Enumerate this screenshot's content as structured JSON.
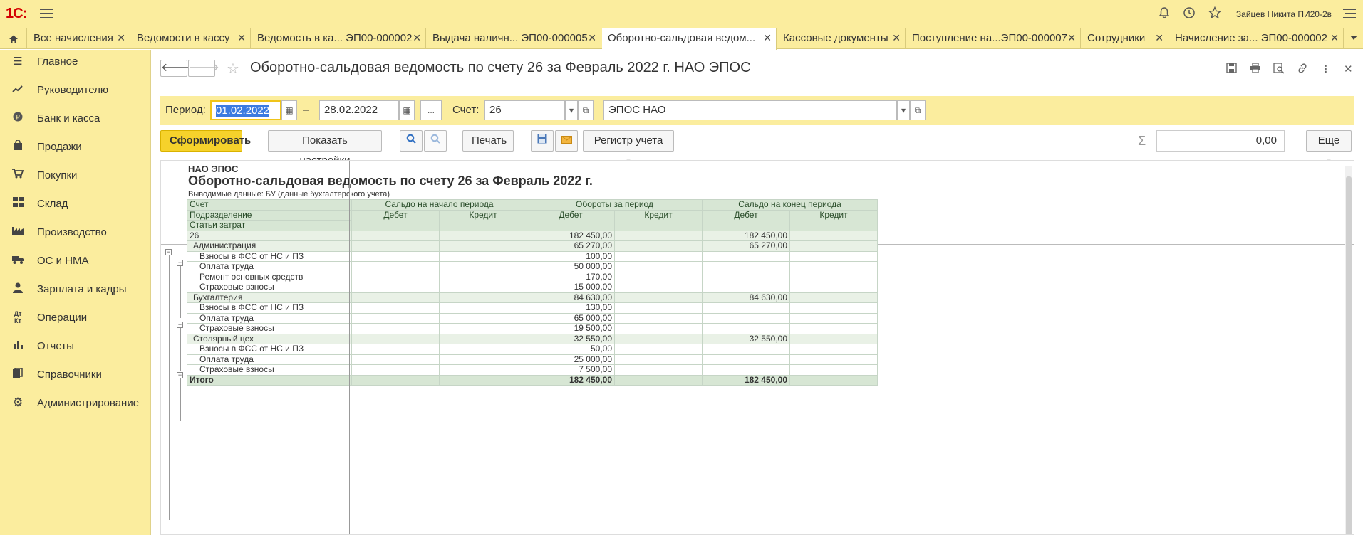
{
  "header": {
    "user": "Зайцев Никита ПИ20-2в"
  },
  "tabs": [
    {
      "label": "Все начисления"
    },
    {
      "label": "Ведомости в кассу"
    },
    {
      "label": "Ведомость в ка... ЭП00-000002"
    },
    {
      "label": "Выдача наличн... ЭП00-000005"
    },
    {
      "label": "Оборотно-сальдовая ведом..."
    },
    {
      "label": "Кассовые документы"
    },
    {
      "label": "Поступление на...ЭП00-000007"
    },
    {
      "label": "Сотрудники"
    },
    {
      "label": "Начисление за... ЭП00-000002"
    }
  ],
  "sidebar": [
    {
      "label": "Главное",
      "icon": "menu-icon"
    },
    {
      "label": "Руководителю",
      "icon": "chart-line-icon"
    },
    {
      "label": "Банк и касса",
      "icon": "ruble-icon"
    },
    {
      "label": "Продажи",
      "icon": "shopping-bag-icon"
    },
    {
      "label": "Покупки",
      "icon": "cart-icon"
    },
    {
      "label": "Склад",
      "icon": "warehouse-icon"
    },
    {
      "label": "Производство",
      "icon": "factory-icon"
    },
    {
      "label": "ОС и НМА",
      "icon": "truck-icon"
    },
    {
      "label": "Зарплата и кадры",
      "icon": "person-icon"
    },
    {
      "label": "Операции",
      "icon": "operations-icon"
    },
    {
      "label": "Отчеты",
      "icon": "bar-chart-icon"
    },
    {
      "label": "Справочники",
      "icon": "books-icon"
    },
    {
      "label": "Администрирование",
      "icon": "gear-icon"
    }
  ],
  "document": {
    "title": "Оборотно-сальдовая ведомость по счету 26 за Февраль 2022 г. НАО ЭПОС"
  },
  "filters": {
    "period_label": "Период:",
    "date_from": "01.02.2022",
    "dash": "–",
    "date_to": "28.02.2022",
    "ellipsis": "...",
    "account_label": "Счет:",
    "account": "26",
    "organization": "ЭПОС НАО"
  },
  "toolbar": {
    "generate": "Сформировать",
    "show_settings": "Показать настройки",
    "print": "Печать",
    "register": "Регистр учета",
    "sum": "0,00",
    "more": "Еще"
  },
  "report": {
    "org": "НАО ЭПОС",
    "title": "Оборотно-сальдовая ведомость по счету 26 за Февраль 2022 г.",
    "subtitle": "Выводимые данные:   БУ (данные бухгалтерского учета)",
    "header": {
      "account": "Счет",
      "division": "Подразделение",
      "cost_items": "Статьи затрат",
      "opening": "Сальдо на начало периода",
      "turnover": "Обороты за период",
      "closing": "Сальдо на конец периода",
      "debit": "Дебет",
      "credit": "Кредит"
    },
    "rows": [
      {
        "name": "26",
        "level": 0,
        "od": "",
        "oc": "",
        "td": "182 450,00",
        "tc": "",
        "cd": "182 450,00",
        "cc": ""
      },
      {
        "name": "Администрация",
        "level": 1,
        "od": "",
        "oc": "",
        "td": "65 270,00",
        "tc": "",
        "cd": "65 270,00",
        "cc": ""
      },
      {
        "name": "Взносы в ФСС от НС и ПЗ",
        "level": 2,
        "od": "",
        "oc": "",
        "td": "100,00",
        "tc": "",
        "cd": "",
        "cc": ""
      },
      {
        "name": "Оплата труда",
        "level": 2,
        "od": "",
        "oc": "",
        "td": "50 000,00",
        "tc": "",
        "cd": "",
        "cc": ""
      },
      {
        "name": "Ремонт основных средств",
        "level": 2,
        "od": "",
        "oc": "",
        "td": "170,00",
        "tc": "",
        "cd": "",
        "cc": ""
      },
      {
        "name": "Страховые взносы",
        "level": 2,
        "od": "",
        "oc": "",
        "td": "15 000,00",
        "tc": "",
        "cd": "",
        "cc": ""
      },
      {
        "name": "Бухгалтерия",
        "level": 1,
        "od": "",
        "oc": "",
        "td": "84 630,00",
        "tc": "",
        "cd": "84 630,00",
        "cc": ""
      },
      {
        "name": "Взносы в ФСС от НС и ПЗ",
        "level": 2,
        "od": "",
        "oc": "",
        "td": "130,00",
        "tc": "",
        "cd": "",
        "cc": ""
      },
      {
        "name": "Оплата труда",
        "level": 2,
        "od": "",
        "oc": "",
        "td": "65 000,00",
        "tc": "",
        "cd": "",
        "cc": ""
      },
      {
        "name": "Страховые взносы",
        "level": 2,
        "od": "",
        "oc": "",
        "td": "19 500,00",
        "tc": "",
        "cd": "",
        "cc": ""
      },
      {
        "name": "Столярный цех",
        "level": 1,
        "od": "",
        "oc": "",
        "td": "32 550,00",
        "tc": "",
        "cd": "32 550,00",
        "cc": ""
      },
      {
        "name": "Взносы в ФСС от НС и ПЗ",
        "level": 2,
        "od": "",
        "oc": "",
        "td": "50,00",
        "tc": "",
        "cd": "",
        "cc": ""
      },
      {
        "name": "Оплата труда",
        "level": 2,
        "od": "",
        "oc": "",
        "td": "25 000,00",
        "tc": "",
        "cd": "",
        "cc": ""
      },
      {
        "name": "Страховые взносы",
        "level": 2,
        "od": "",
        "oc": "",
        "td": "7 500,00",
        "tc": "",
        "cd": "",
        "cc": ""
      }
    ],
    "total": {
      "name": "Итого",
      "od": "",
      "oc": "",
      "td": "182 450,00",
      "tc": "",
      "cd": "182 450,00",
      "cc": ""
    }
  },
  "colors": {
    "accent_yellow": "#fbed9e",
    "primary_button": "#f6d22b",
    "table_header": "#d7e6d4",
    "logo_red": "#d40000"
  }
}
